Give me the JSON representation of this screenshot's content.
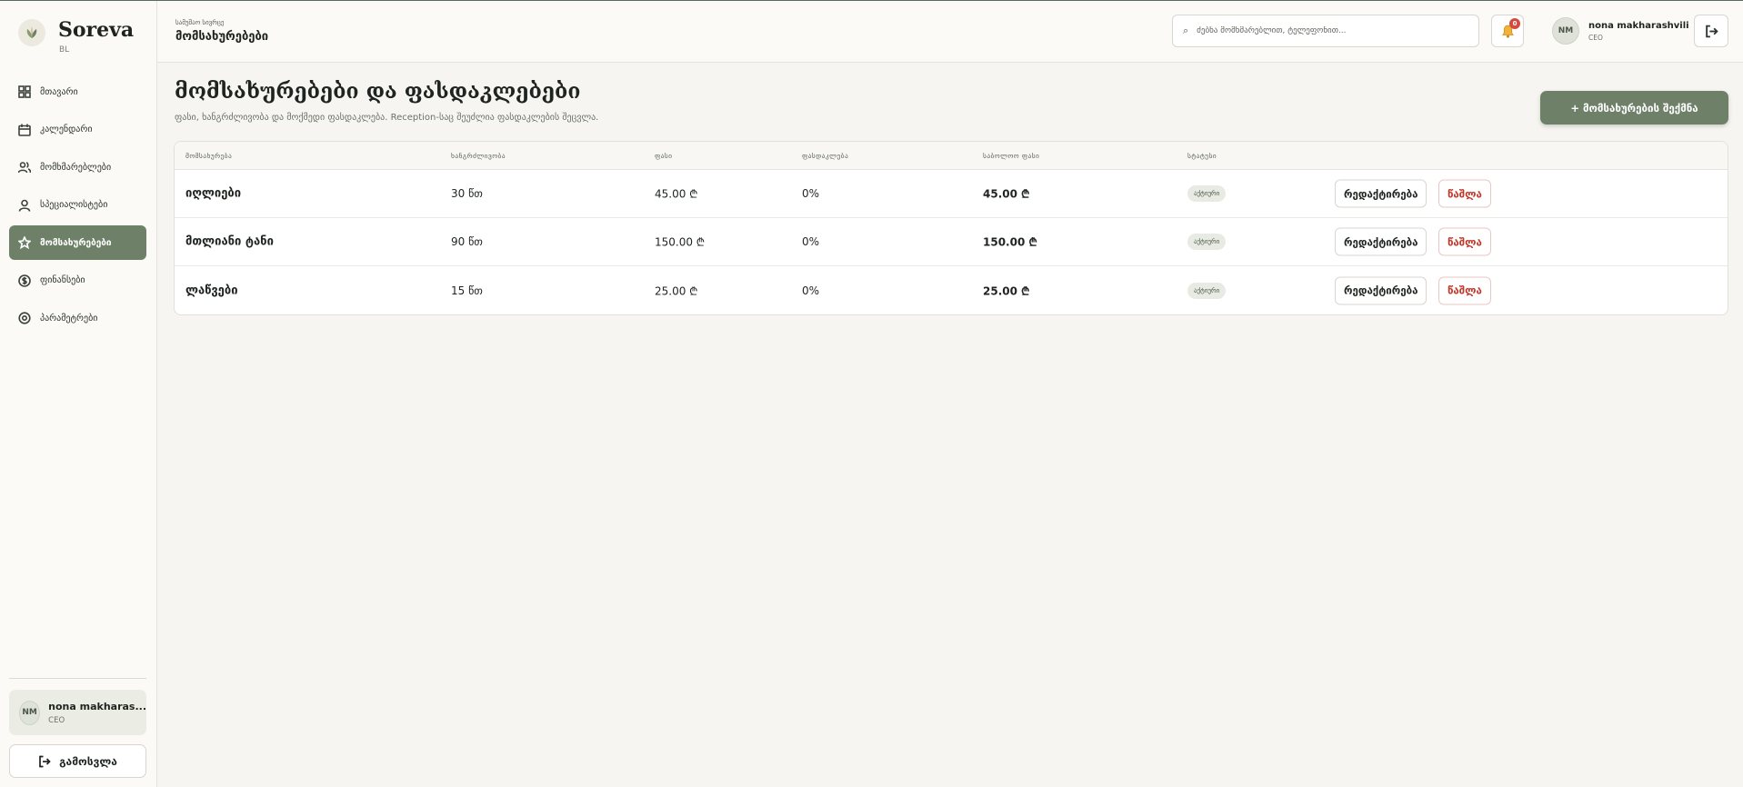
{
  "brand": {
    "name": "Soreva",
    "sub": "BL",
    "logo_icon": "lotus-leaf-icon"
  },
  "sidebar": {
    "items": [
      {
        "label": "მთავარი",
        "icon": "grid-icon",
        "active": false
      },
      {
        "label": "კალენდარი",
        "icon": "calendar-icon",
        "active": false
      },
      {
        "label": "მომხმარებლები",
        "icon": "users-icon",
        "active": false
      },
      {
        "label": "სპეციალისტები",
        "icon": "user-icon",
        "active": false
      },
      {
        "label": "მომსახურებები",
        "icon": "star-icon",
        "active": true
      },
      {
        "label": "ფინანსები",
        "icon": "dollar-circle-icon",
        "active": false
      },
      {
        "label": "პარამეტრები",
        "icon": "settings-icon",
        "active": false
      }
    ],
    "user": {
      "initials": "NM",
      "name": "nona makharas...",
      "role": "CEO"
    },
    "logout_label": "გამოსვლა"
  },
  "header": {
    "crumb_small": "სამუშაო სივრცე",
    "crumb_title": "მომსახურებები",
    "search_placeholder": "ძებნა მომხმარებლით, ტელეფონით...",
    "notification_count": "0",
    "user": {
      "initials": "NM",
      "name": "nona makharashvili",
      "role": "CEO"
    }
  },
  "main": {
    "title": "მომსახურებები და ფასდაკლებები",
    "subtitle": "ფასი, ხანგრძლივობა და მოქმედი ფასდაკლება. Reception-საც შეუძლია ფასდაკლების შეცვლა.",
    "create_label": "+ მომსახურების შექმნა"
  },
  "table": {
    "columns": [
      "მომსახურება",
      "ხანგრძლივობა",
      "ფასი",
      "ფასდაკლება",
      "საბოლოო ფასი",
      "სტატუსი"
    ],
    "rows": [
      {
        "name": "იღლიები",
        "duration": "30 წთ",
        "price": "45.00 ₾",
        "discount": "0%",
        "final": "45.00 ₾",
        "status": "აქტიური"
      },
      {
        "name": "მთლიანი ტანი",
        "duration": "90 წთ",
        "price": "150.00 ₾",
        "discount": "0%",
        "final": "150.00 ₾",
        "status": "აქტიური"
      },
      {
        "name": "ლაწვები",
        "duration": "15 წთ",
        "price": "25.00 ₾",
        "discount": "0%",
        "final": "25.00 ₾",
        "status": "აქტიური"
      }
    ],
    "edit_label": "რედაქტირება",
    "delete_label": "წაშლა"
  },
  "colors": {
    "accent": "#6f8069",
    "danger": "#c0392b",
    "badge_bg": "#e8ebe3",
    "page_bg": "#f6f5f1"
  }
}
